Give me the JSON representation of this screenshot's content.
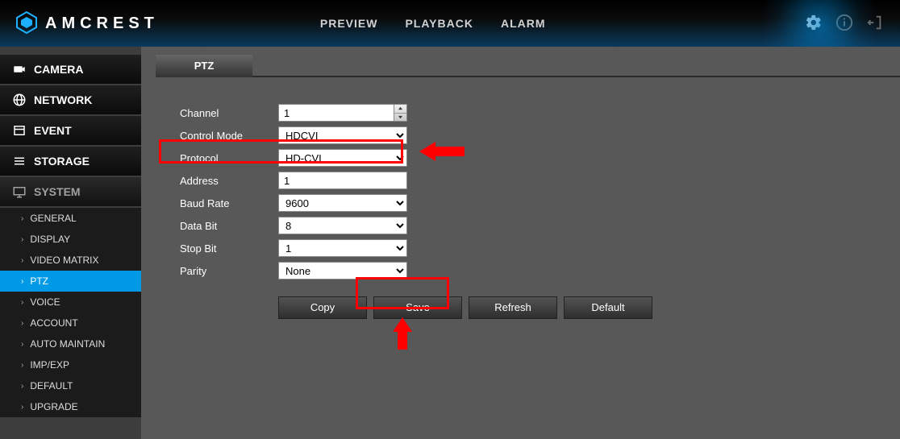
{
  "brand": "AMCREST",
  "nav": {
    "tabs": [
      "PREVIEW",
      "PLAYBACK",
      "ALARM"
    ]
  },
  "sidebar": {
    "items": [
      {
        "label": "CAMERA"
      },
      {
        "label": "NETWORK"
      },
      {
        "label": "EVENT"
      },
      {
        "label": "STORAGE"
      },
      {
        "label": "SYSTEM"
      }
    ],
    "system_sub": [
      "GENERAL",
      "DISPLAY",
      "VIDEO MATRIX",
      "PTZ",
      "VOICE",
      "ACCOUNT",
      "AUTO MAINTAIN",
      "IMP/EXP",
      "DEFAULT",
      "UPGRADE"
    ],
    "active_sub": "PTZ"
  },
  "content": {
    "tab": "PTZ",
    "fields": {
      "channel": {
        "label": "Channel",
        "value": "1"
      },
      "control_mode": {
        "label": "Control Mode",
        "value": "HDCVI"
      },
      "protocol": {
        "label": "Protocol",
        "value": "HD-CVI"
      },
      "address": {
        "label": "Address",
        "value": "1"
      },
      "baud_rate": {
        "label": "Baud Rate",
        "value": "9600"
      },
      "data_bit": {
        "label": "Data Bit",
        "value": "8"
      },
      "stop_bit": {
        "label": "Stop Bit",
        "value": "1"
      },
      "parity": {
        "label": "Parity",
        "value": "None"
      }
    },
    "buttons": {
      "copy": "Copy",
      "save": "Save",
      "refresh": "Refresh",
      "default": "Default"
    }
  }
}
